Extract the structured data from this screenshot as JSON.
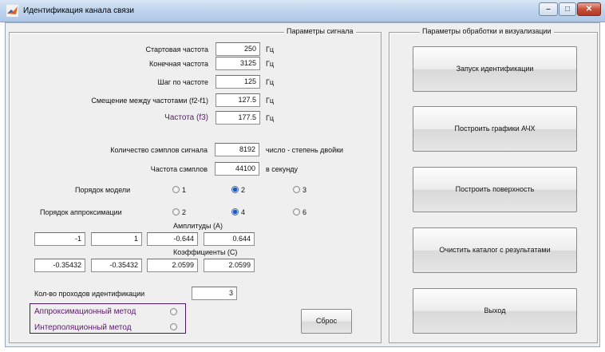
{
  "window": {
    "title": "Идентификация канала связи",
    "minimize": "–",
    "maximize": "□",
    "close": "✕"
  },
  "signal_panel": {
    "title": "Параметры сигнала",
    "start_freq": {
      "label": "Стартовая частота",
      "value": "250",
      "unit": "Гц"
    },
    "end_freq": {
      "label": "Конечная частота",
      "value": "3125",
      "unit": "Гц"
    },
    "freq_step": {
      "label": "Шаг по частоте",
      "value": "125",
      "unit": "Гц"
    },
    "freq_offset": {
      "label": "Смещение между частотами (f2-f1)",
      "value": "127.5",
      "unit": "Гц"
    },
    "freq_f3": {
      "label": "Частота (f3)",
      "value": "177.5",
      "unit": "Гц"
    },
    "sample_count": {
      "label": "Количество сэмплов сигнала",
      "value": "8192",
      "unit": "число - степень двойки"
    },
    "sample_rate": {
      "label": "Частота сэмплов",
      "value": "44100",
      "unit": "в секунду"
    },
    "model_order": {
      "label": "Порядок модели",
      "options": [
        "1",
        "2",
        "3"
      ],
      "selected": "2"
    },
    "approx_order": {
      "label": "Порядок аппроксимации",
      "options": [
        "2",
        "4",
        "6"
      ],
      "selected": "4"
    },
    "amplitudes": {
      "label": "Амплитуды (A)",
      "values": [
        "-1",
        "1",
        "-0.644",
        "0.644"
      ]
    },
    "coefficients": {
      "label": "Коэффициенты (C)",
      "values": [
        "-0.35432",
        "-0.35432",
        "2.0599",
        "2.0599"
      ]
    },
    "passes": {
      "label": "Кол-во проходов идентификации",
      "value": "3"
    },
    "method_approx": {
      "label": "Аппроксимационный метод"
    },
    "method_interp": {
      "label": "Интерполяционный метод"
    },
    "reset_button": "Сброс"
  },
  "processing_panel": {
    "title": "Параметры обработки и визуализации",
    "buttons": [
      "Запуск идентификации",
      "Построить графики АЧХ",
      "Построить поверхность",
      "Очистить каталог с результатами",
      "Выход"
    ]
  },
  "colors": {
    "f3_label": "#5a1a6b",
    "method_label": "#5a1a6b",
    "method_box_border": "#4a1a5a"
  }
}
